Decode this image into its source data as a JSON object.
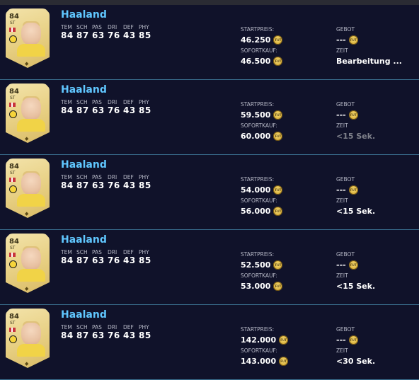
{
  "stat_labels": [
    "TEM",
    "SCH",
    "PAS",
    "DRI",
    "DEF",
    "PHY"
  ],
  "labels": {
    "start_price": "STARTPREIS:",
    "buy_now": "SOFORTKAUF:",
    "bid": "GEBOT",
    "time": "ZEIT"
  },
  "coin_label": "FUT",
  "card": {
    "rating": "84",
    "position": "ST",
    "emblem": "◆"
  },
  "rows": [
    {
      "name": "Haaland",
      "stats": [
        "84",
        "87",
        "63",
        "76",
        "43",
        "85"
      ],
      "start_price": "46.250",
      "buy_now": "46.500",
      "bid": "---",
      "time": "Bearbeitung ...",
      "time_muted": false
    },
    {
      "name": "Haaland",
      "stats": [
        "84",
        "87",
        "63",
        "76",
        "43",
        "85"
      ],
      "start_price": "59.500",
      "buy_now": "60.000",
      "bid": "---",
      "time": "<15 Sek.",
      "time_muted": true
    },
    {
      "name": "Haaland",
      "stats": [
        "84",
        "87",
        "63",
        "76",
        "43",
        "85"
      ],
      "start_price": "54.000",
      "buy_now": "56.000",
      "bid": "---",
      "time": "<15 Sek.",
      "time_muted": false
    },
    {
      "name": "Haaland",
      "stats": [
        "84",
        "87",
        "63",
        "76",
        "43",
        "85"
      ],
      "start_price": "52.500",
      "buy_now": "53.000",
      "bid": "---",
      "time": "<15 Sek.",
      "time_muted": false
    },
    {
      "name": "Haaland",
      "stats": [
        "84",
        "87",
        "63",
        "76",
        "43",
        "85"
      ],
      "start_price": "142.000",
      "buy_now": "143.000",
      "bid": "---",
      "time": "<30 Sek.",
      "time_muted": false
    }
  ]
}
